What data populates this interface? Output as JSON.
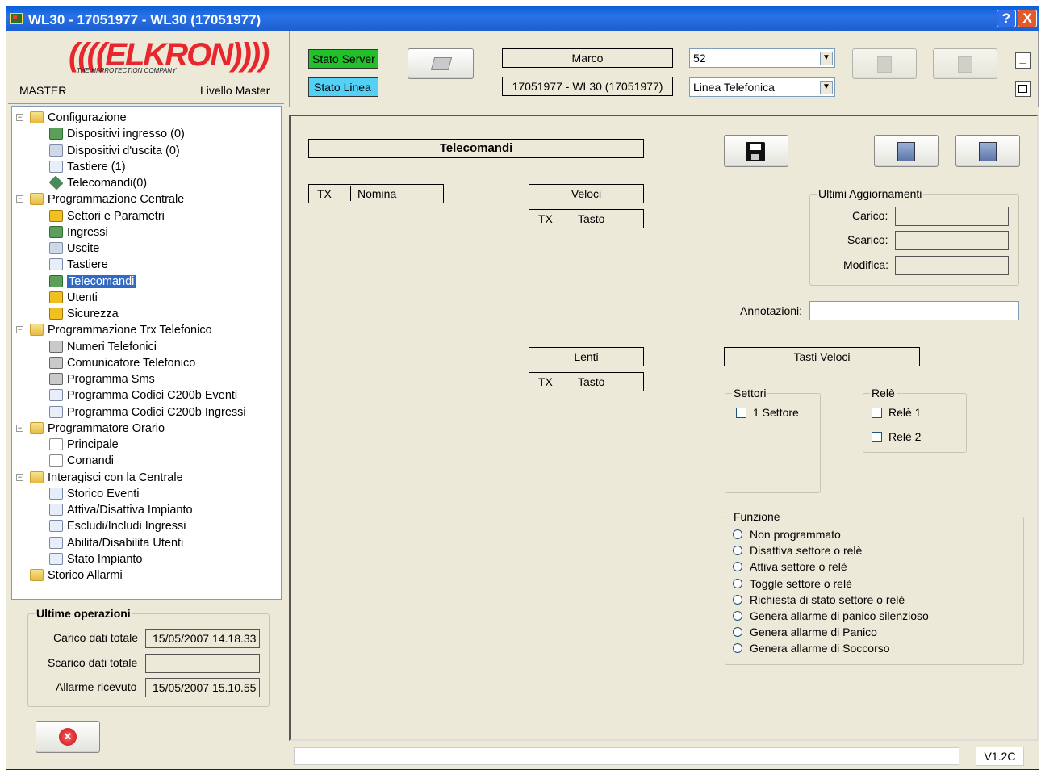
{
  "window": {
    "title": "WL30 - 17051977 - WL30 (17051977)",
    "help": "?",
    "close": "X"
  },
  "header": {
    "logo": "((((ELKRON))))",
    "tagline": "THE HI-PROTECTION COMPANY",
    "user": "MASTER",
    "level": "Livello Master"
  },
  "tree": [
    {
      "label": "Configurazione",
      "icon": "folder-icon"
    },
    {
      "label": "Dispositivi ingresso (0)",
      "icon": "input-device-icon"
    },
    {
      "label": "Dispositivi d'uscita (0)",
      "icon": "output-device-icon"
    },
    {
      "label": "Tastiere (1)",
      "icon": "keypad-icon"
    },
    {
      "label": "Telecomandi(0)",
      "icon": "remote-icon"
    },
    {
      "label": "Programmazione Centrale",
      "icon": "folder-icon"
    },
    {
      "label": "Settori e Parametri",
      "icon": "home-icon"
    },
    {
      "label": "Ingressi",
      "icon": "input-device-icon"
    },
    {
      "label": "Uscite",
      "icon": "output-device-icon"
    },
    {
      "label": "Tastiere",
      "icon": "keypad-icon"
    },
    {
      "label": "Telecomandi",
      "icon": "arrow-icon"
    },
    {
      "label": "Utenti",
      "icon": "users-icon"
    },
    {
      "label": "Sicurezza",
      "icon": "lock-icon"
    },
    {
      "label": "Programmazione Trx Telefonico",
      "icon": "folder-icon"
    },
    {
      "label": "Numeri Telefonici",
      "icon": "phone-icon"
    },
    {
      "label": "Comunicatore Telefonico",
      "icon": "phone-icon"
    },
    {
      "label": "Programma Sms",
      "icon": "mobile-icon"
    },
    {
      "label": "Programma Codici C200b Eventi",
      "icon": "table-icon"
    },
    {
      "label": "Programma Codici C200b Ingressi",
      "icon": "table-icon"
    },
    {
      "label": "Programmatore Orario",
      "icon": "folder-icon"
    },
    {
      "label": "Principale",
      "icon": "clock-icon"
    },
    {
      "label": "Comandi",
      "icon": "clock-icon"
    },
    {
      "label": "Interagisci con la Centrale",
      "icon": "folder-icon"
    },
    {
      "label": "Storico Eventi",
      "icon": "list-icon"
    },
    {
      "label": "Attiva/Disattiva Impianto",
      "icon": "list-icon"
    },
    {
      "label": "Escludi/Includi Ingressi",
      "icon": "list-icon"
    },
    {
      "label": "Abilita/Disabilita Utenti",
      "icon": "list-icon"
    },
    {
      "label": "Stato Impianto",
      "icon": "list-icon"
    },
    {
      "label": "Storico Allarmi",
      "icon": "folder-icon"
    }
  ],
  "last_ops": {
    "title": "Ultime operazioni",
    "load_label": "Carico dati totale",
    "load_value": "15/05/2007 14.18.33",
    "unload_label": "Scarico dati totale",
    "unload_value": "",
    "alarm_label": "Allarme ricevuto",
    "alarm_value": "15/05/2007 15.10.55"
  },
  "topbar": {
    "server": "Stato Server",
    "line": "Stato Linea",
    "name": "Marco",
    "device": "17051977 - WL30 (17051977)",
    "combo1": "52",
    "combo2": "Linea Telefonica",
    "min": "_"
  },
  "main": {
    "title": "Telecomandi",
    "list_tx": "TX",
    "list_name": "Nomina",
    "veloci": "Veloci",
    "lenti": "Lenti",
    "tx": "TX",
    "tasto": "Tasto",
    "updates": {
      "title": "Ultimi Aggiornamenti",
      "carico": "Carico:",
      "scarico": "Scarico:",
      "modifica": "Modifica:"
    },
    "notes": "Annotazioni:",
    "tasti_veloci": "Tasti Veloci",
    "settori": {
      "title": "Settori",
      "items": [
        "1 Settore"
      ]
    },
    "rele": {
      "title": "Relè",
      "items": [
        "Relè 1",
        "Relè 2"
      ]
    },
    "funzione": {
      "title": "Funzione",
      "options": [
        "Non programmato",
        "Disattiva settore o relè",
        "Attiva settore o relè",
        "Toggle settore o relè",
        "Richiesta di stato settore o relè",
        "Genera allarme di panico silenzioso",
        "Genera allarme di Panico",
        "Genera allarme di Soccorso"
      ]
    }
  },
  "version": "V1.2C",
  "colors": {
    "status_green": "#22c02a",
    "status_cyan": "#55d0f5",
    "selection": "#316ac5",
    "close_red": "#d8232a"
  }
}
